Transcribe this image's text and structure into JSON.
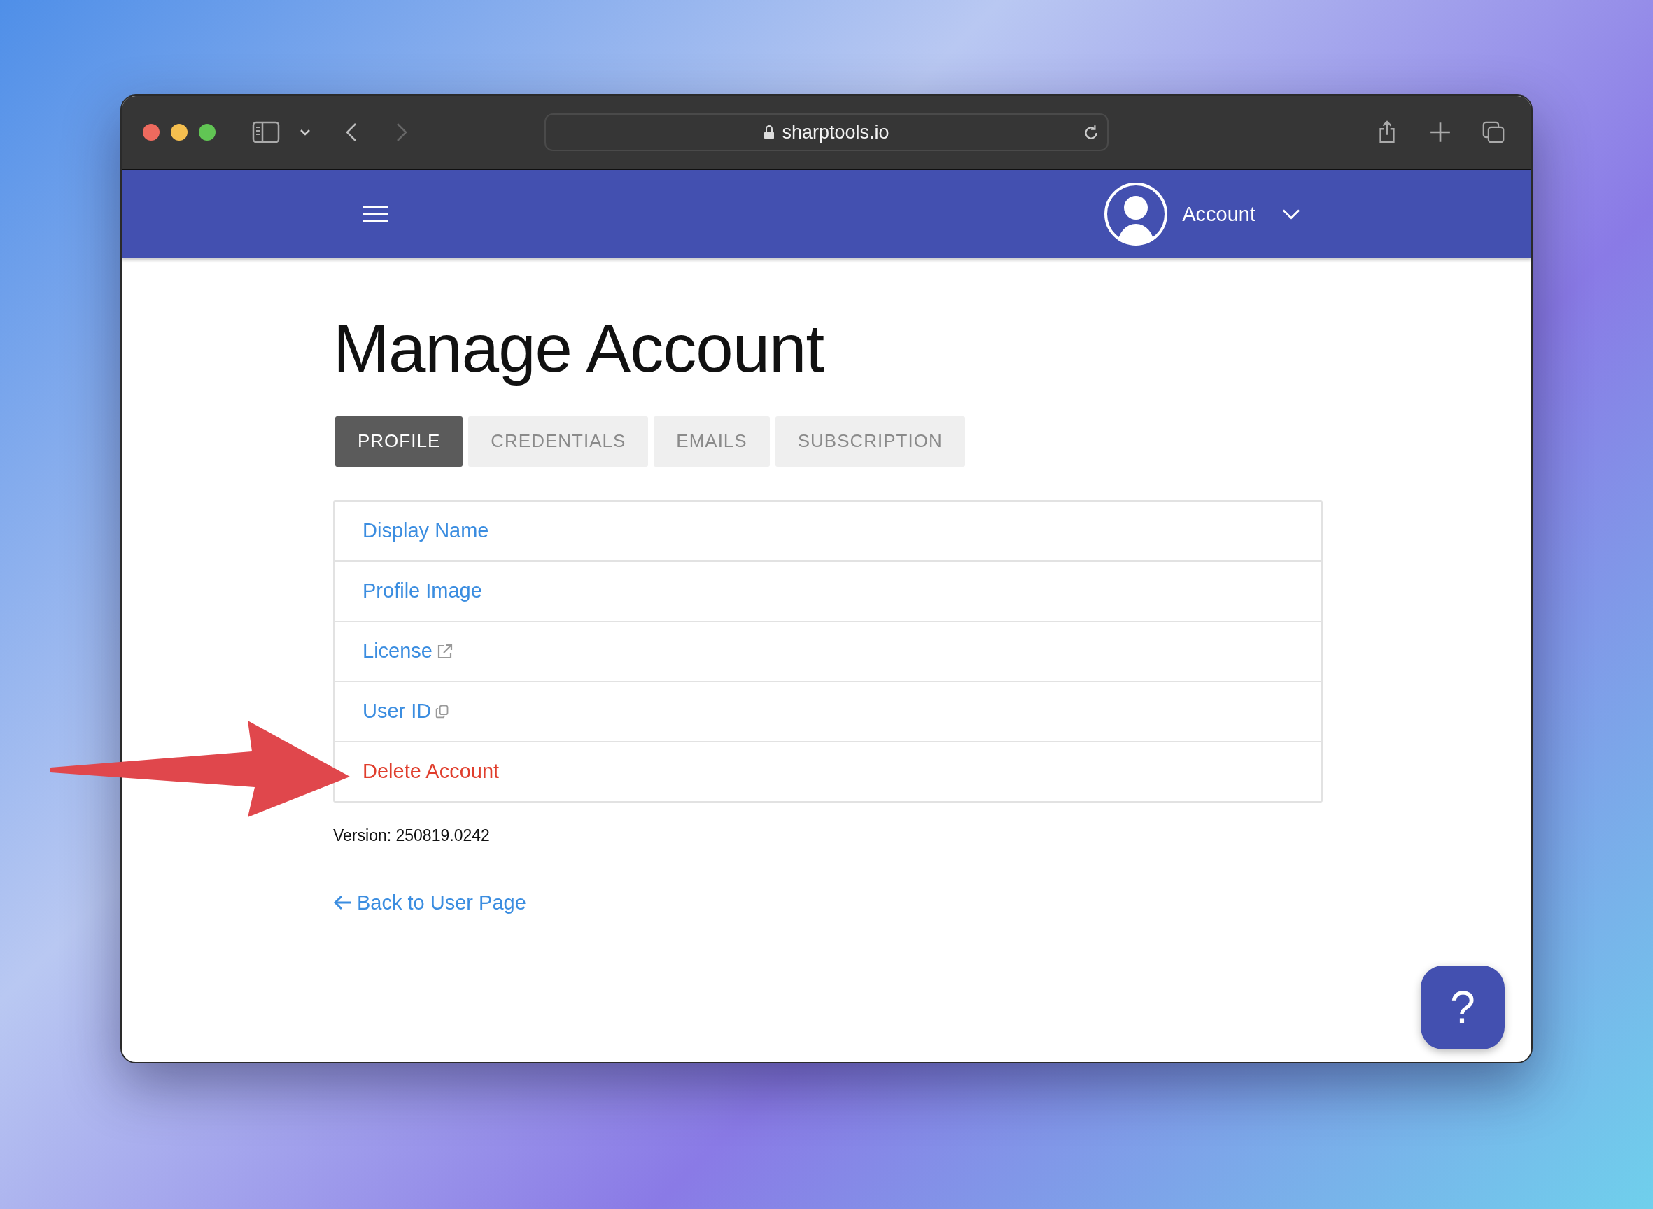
{
  "browser": {
    "address": "sharptools.io"
  },
  "header": {
    "account_label": "Account"
  },
  "page": {
    "title": "Manage Account"
  },
  "tabs": [
    {
      "label": "PROFILE",
      "selected": true
    },
    {
      "label": "CREDENTIALS",
      "selected": false
    },
    {
      "label": "EMAILS",
      "selected": false
    },
    {
      "label": "SUBSCRIPTION",
      "selected": false
    }
  ],
  "items": [
    {
      "label": "Display Name",
      "kind": "plain"
    },
    {
      "label": "Profile Image",
      "kind": "plain"
    },
    {
      "label": "License",
      "kind": "external"
    },
    {
      "label": "User ID",
      "kind": "copy"
    },
    {
      "label": "Delete Account",
      "kind": "danger"
    }
  ],
  "version": "Version: 250819.0242",
  "back_link": "Back to User Page",
  "help_button": {
    "label": "?"
  }
}
